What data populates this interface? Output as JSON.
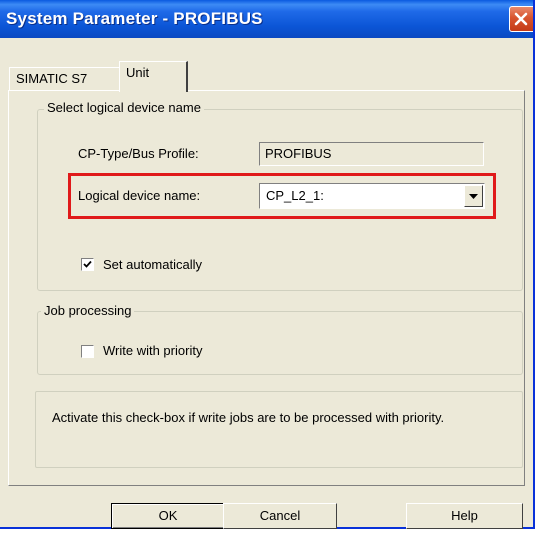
{
  "window": {
    "title": "System Parameter - PROFIBUS"
  },
  "tabs": [
    {
      "label": "SIMATIC S7",
      "active": false
    },
    {
      "label": "Unit",
      "active": true
    }
  ],
  "logical_device_group": {
    "legend": "Select logical device name",
    "cp_type_label": "CP-Type/Bus Profile:",
    "cp_type_value": "PROFIBUS",
    "device_name_label": "Logical device name:",
    "device_name_value": "CP_L2_1:",
    "set_automatically_label": "Set automatically",
    "set_automatically_checked": true
  },
  "job_processing_group": {
    "legend": "Job processing",
    "write_priority_label": "Write with priority",
    "write_priority_checked": false
  },
  "info": {
    "text": "Activate this check-box if write jobs are to be processed with priority."
  },
  "buttons": {
    "ok": "OK",
    "cancel": "Cancel",
    "help": "Help"
  },
  "colors": {
    "title_bar": "#0b55d6",
    "highlight": "#e0191a",
    "dialog_bg": "#ece9d8"
  }
}
